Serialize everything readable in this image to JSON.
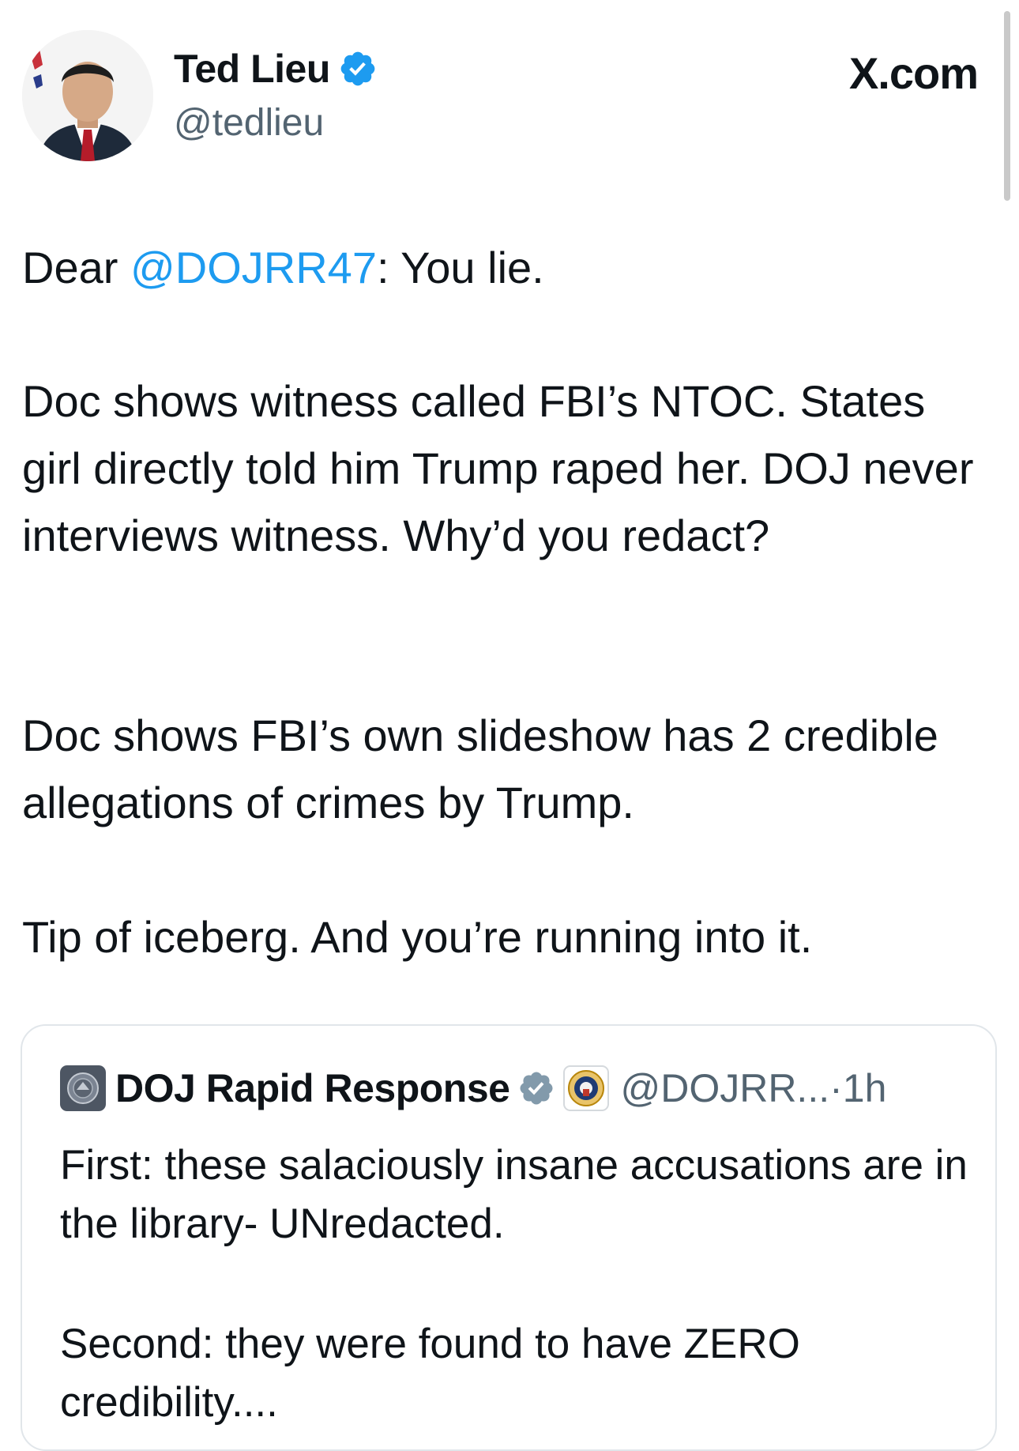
{
  "author": {
    "name": "Ted Lieu",
    "handle": "@tedlieu"
  },
  "site_logo": "X.com",
  "tweet": {
    "line1_prefix": "Dear ",
    "line1_mention": "@DOJRR47",
    "line1_suffix": ": You lie.",
    "para2": "Doc shows witness called FBI’s NTOC. States girl directly told him Trump raped her. DOJ never interviews witness. Why’d you redact?",
    "para3": "Doc shows FBI’s own slideshow has 2 credible allegations of crimes by Trump.",
    "para4": "Tip of iceberg. And you’re running into it."
  },
  "quoted": {
    "name": "DOJ Rapid Response",
    "handle": "@DOJRR...",
    "separator": "·",
    "time": "1h",
    "para1": "First: these salaciously insane accusations are in the library- UNredacted.",
    "para2": "Second: they were found to have ZERO credibility...."
  },
  "colors": {
    "verified_blue": "#1d9bf0",
    "verified_gray": "#829aab",
    "mention_blue": "#1d9bf0"
  },
  "icons": [
    "avatar",
    "verified-badge-icon",
    "x-logo",
    "doj-avatar",
    "gray-verified-badge-icon",
    "doj-seal-icon"
  ]
}
